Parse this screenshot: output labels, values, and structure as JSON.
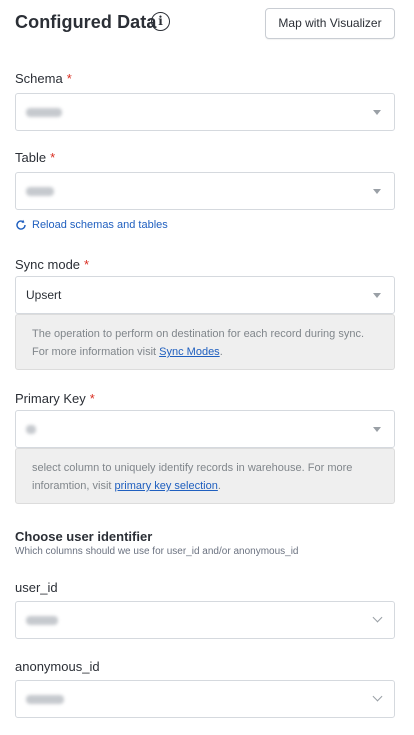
{
  "header": {
    "title": "Configured Data",
    "info_icon": "info-icon",
    "map_button": "Map with Visualizer"
  },
  "schema": {
    "label": "Schema",
    "required": "*",
    "value": "loyalty",
    "value_blurred": true
  },
  "table": {
    "label": "Table",
    "required": "*",
    "value": "users",
    "value_blurred": true
  },
  "reload": {
    "label": "Reload schemas and tables",
    "icon": "refresh-icon"
  },
  "sync_mode": {
    "label": "Sync mode",
    "required": "*",
    "value": "Upsert",
    "help_text": "The operation to perform on destination for each record during sync. For more information visit ",
    "help_link": "Sync Modes",
    "help_end": "."
  },
  "primary_key": {
    "label": "Primary Key",
    "required": "*",
    "value": "id",
    "value_blurred": true,
    "help_text": "select column to uniquely identify records in warehouse. For more inforamtion, visit ",
    "help_link": "primary key selection",
    "help_end": "."
  },
  "identifier": {
    "title": "Choose user identifier",
    "subtitle": "Which columns should we use for user_id and/or anonymous_id"
  },
  "user_id": {
    "label": "user_id",
    "value": "email",
    "value_blurred": true
  },
  "anonymous_id": {
    "label": "anonymous_id",
    "value": "userid_in",
    "value_blurred": true
  },
  "colors": {
    "accent": "#1f5fbf",
    "required": "#d92d20",
    "help_bg": "#efefef"
  }
}
